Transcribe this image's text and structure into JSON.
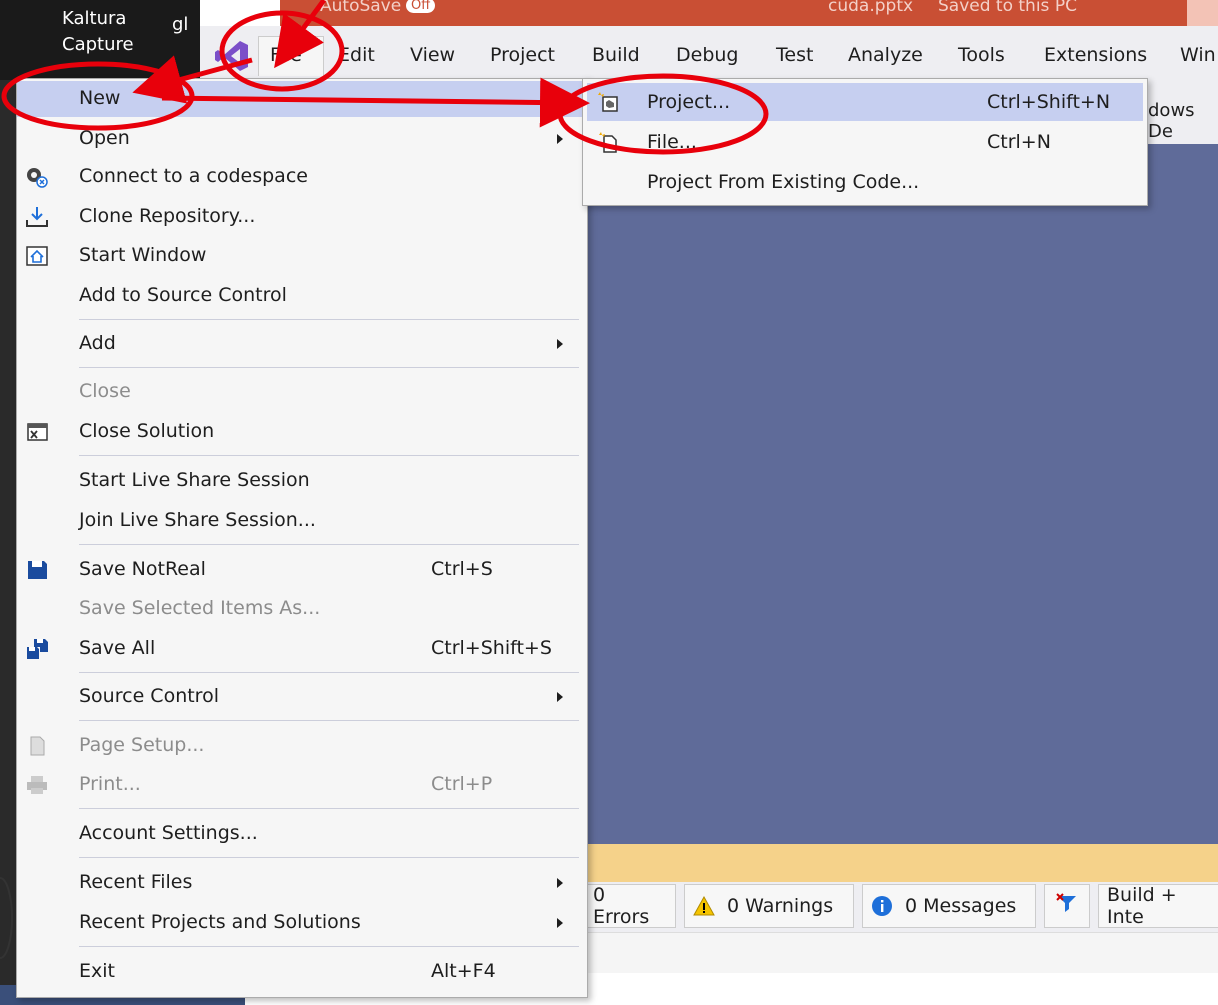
{
  "kaltura": {
    "line1": "Kaltura",
    "line2": "Capture",
    "extra": "gl"
  },
  "titlebar": {
    "autosave": "AutoSave",
    "toggle": "Off",
    "filename": "cuda.pptx",
    "saved": "Saved to this PC"
  },
  "menubar": {
    "items": [
      "File",
      "Edit",
      "View",
      "Project",
      "Build",
      "Debug",
      "Test",
      "Analyze",
      "Tools",
      "Extensions",
      "Win"
    ]
  },
  "toolbar": {
    "partial_text": "dows De"
  },
  "file_menu": {
    "items": [
      {
        "label": "New",
        "submenu": true
      },
      {
        "label": "Open",
        "submenu": true
      },
      {
        "label": "Connect to a codespace",
        "icon": "codespace-icon"
      },
      {
        "label": "Clone Repository...",
        "icon": "clone-download-icon"
      },
      {
        "label": "Start Window",
        "icon": "start-window-icon"
      },
      {
        "label": "Add to Source Control"
      },
      {
        "label": "Add",
        "submenu": true
      },
      {
        "label": "Close",
        "disabled": true
      },
      {
        "label": "Close Solution",
        "icon": "close-solution-icon"
      },
      {
        "label": "Start Live Share Session"
      },
      {
        "label": "Join Live Share Session..."
      },
      {
        "label": "Save NotReal",
        "shortcut": "Ctrl+S",
        "icon": "save-icon"
      },
      {
        "label": "Save Selected Items As...",
        "disabled": true
      },
      {
        "label": "Save All",
        "shortcut": "Ctrl+Shift+S",
        "icon": "save-all-icon"
      },
      {
        "label": "Source Control",
        "submenu": true
      },
      {
        "label": "Page Setup...",
        "disabled": true,
        "icon": "page-setup-icon"
      },
      {
        "label": "Print...",
        "shortcut": "Ctrl+P",
        "disabled": true,
        "icon": "print-icon"
      },
      {
        "label": "Account Settings..."
      },
      {
        "label": "Recent Files",
        "submenu": true
      },
      {
        "label": "Recent Projects and Solutions",
        "submenu": true
      },
      {
        "label": "Exit",
        "shortcut": "Alt+F4"
      }
    ]
  },
  "new_submenu": {
    "items": [
      {
        "label": "Project...",
        "shortcut": "Ctrl+Shift+N",
        "icon": "new-project-icon"
      },
      {
        "label": "File...",
        "shortcut": "Ctrl+N",
        "icon": "new-file-icon"
      },
      {
        "label": "Project From Existing Code..."
      }
    ]
  },
  "error_list": {
    "errors": "0 Errors",
    "warnings": "0 Warnings",
    "messages": "0 Messages",
    "scope": "Build + Inte"
  },
  "colors": {
    "accent": "#c6cff0",
    "editor_bg": "#5f6b99",
    "info_bar": "#f5d28a",
    "annotation": "#e8000b",
    "vs_logo": "#7b4fc9"
  }
}
